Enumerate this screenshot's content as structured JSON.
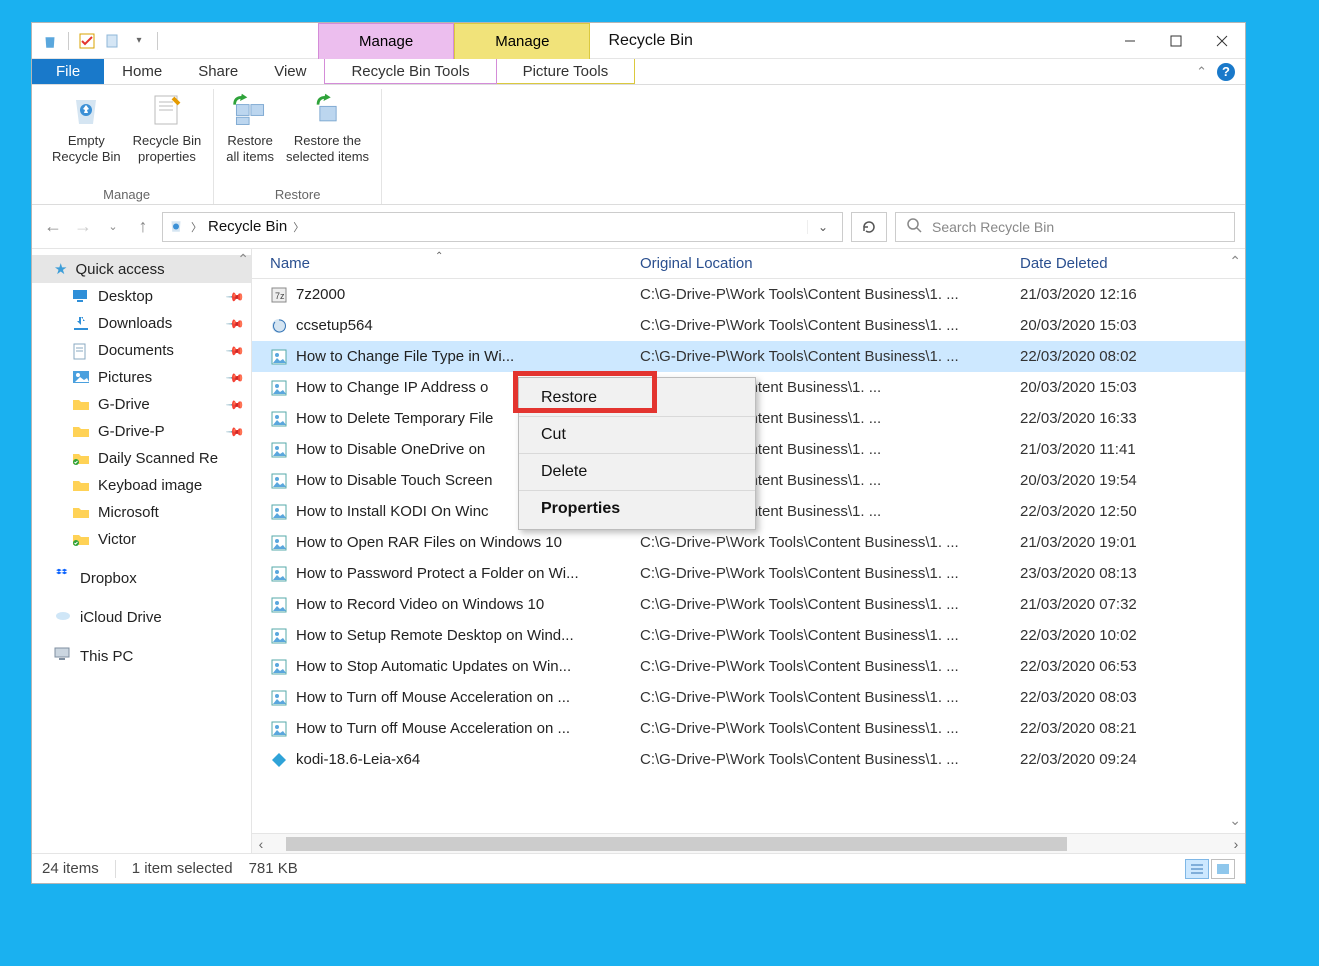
{
  "title": "Recycle Bin",
  "context_tabs": {
    "purple": "Manage",
    "yellow": "Manage"
  },
  "ribbon_tabs": {
    "file": "File",
    "home": "Home",
    "share": "Share",
    "view": "View",
    "rbt": "Recycle Bin Tools",
    "pt": "Picture Tools"
  },
  "ribbon": {
    "empty": "Empty\nRecycle Bin",
    "props": "Recycle Bin\nproperties",
    "manage_group": "Manage",
    "restore_all": "Restore\nall items",
    "restore_sel": "Restore the\nselected items",
    "restore_group": "Restore"
  },
  "addressbar": {
    "location": "Recycle Bin"
  },
  "search": {
    "placeholder": "Search Recycle Bin"
  },
  "nav": {
    "quick_access": "Quick access",
    "items": [
      {
        "label": "Desktop",
        "pinned": true,
        "icon": "desktop"
      },
      {
        "label": "Downloads",
        "pinned": true,
        "icon": "downloads"
      },
      {
        "label": "Documents",
        "pinned": true,
        "icon": "documents"
      },
      {
        "label": "Pictures",
        "pinned": true,
        "icon": "pictures"
      },
      {
        "label": "G-Drive",
        "pinned": true,
        "icon": "folder"
      },
      {
        "label": "G-Drive-P",
        "pinned": true,
        "icon": "folder"
      },
      {
        "label": "Daily Scanned Re",
        "pinned": false,
        "icon": "folder-g"
      },
      {
        "label": "Keyboad image",
        "pinned": false,
        "icon": "folder"
      },
      {
        "label": "Microsoft",
        "pinned": false,
        "icon": "folder"
      },
      {
        "label": "Victor",
        "pinned": false,
        "icon": "folder-g"
      }
    ],
    "dropbox": "Dropbox",
    "icloud": "iCloud Drive",
    "thispc": "This PC"
  },
  "columns": {
    "name": "Name",
    "location": "Original Location",
    "date": "Date Deleted"
  },
  "files": [
    {
      "name": "7z2000",
      "loc": "C:\\G-Drive-P\\Work Tools\\Content Business\\1. ...",
      "date": "21/03/2020 12:16",
      "icon": "exe"
    },
    {
      "name": "ccsetup564",
      "loc": "C:\\G-Drive-P\\Work Tools\\Content Business\\1. ...",
      "date": "20/03/2020 15:03",
      "icon": "exe2"
    },
    {
      "name": "How to Change File Type in Wi...",
      "loc": "C:\\G-Drive-P\\Work Tools\\Content Business\\1. ...",
      "date": "22/03/2020 08:02",
      "icon": "img",
      "selected": true
    },
    {
      "name": "How to Change IP Address o",
      "loc": "...Work Tools\\Content Business\\1. ...",
      "date": "20/03/2020 15:03",
      "icon": "img"
    },
    {
      "name": "How to Delete Temporary File",
      "loc": "...Work Tools\\Content Business\\1. ...",
      "date": "22/03/2020 16:33",
      "icon": "img"
    },
    {
      "name": "How to Disable OneDrive on",
      "loc": "...Work Tools\\Content Business\\1. ...",
      "date": "21/03/2020 11:41",
      "icon": "img"
    },
    {
      "name": "How to Disable Touch Screen",
      "loc": "...Work Tools\\Content Business\\1. ...",
      "date": "20/03/2020 19:54",
      "icon": "img"
    },
    {
      "name": "How to Install KODI On Winc",
      "loc": "...Work Tools\\Content Business\\1. ...",
      "date": "22/03/2020 12:50",
      "icon": "img"
    },
    {
      "name": "How to Open RAR Files on Windows 10",
      "loc": "C:\\G-Drive-P\\Work Tools\\Content Business\\1. ...",
      "date": "21/03/2020 19:01",
      "icon": "img"
    },
    {
      "name": "How to Password Protect a Folder on Wi...",
      "loc": "C:\\G-Drive-P\\Work Tools\\Content Business\\1. ...",
      "date": "23/03/2020 08:13",
      "icon": "img"
    },
    {
      "name": "How to Record Video on Windows 10",
      "loc": "C:\\G-Drive-P\\Work Tools\\Content Business\\1. ...",
      "date": "21/03/2020 07:32",
      "icon": "img"
    },
    {
      "name": "How to Setup Remote Desktop on Wind...",
      "loc": "C:\\G-Drive-P\\Work Tools\\Content Business\\1. ...",
      "date": "22/03/2020 10:02",
      "icon": "img"
    },
    {
      "name": "How to Stop Automatic Updates on Win...",
      "loc": "C:\\G-Drive-P\\Work Tools\\Content Business\\1. ...",
      "date": "22/03/2020 06:53",
      "icon": "img"
    },
    {
      "name": "How to Turn off Mouse Acceleration on ...",
      "loc": "C:\\G-Drive-P\\Work Tools\\Content Business\\1. ...",
      "date": "22/03/2020 08:03",
      "icon": "img"
    },
    {
      "name": "How to Turn off Mouse Acceleration on ...",
      "loc": "C:\\G-Drive-P\\Work Tools\\Content Business\\1. ...",
      "date": "22/03/2020 08:21",
      "icon": "img"
    },
    {
      "name": "kodi-18.6-Leia-x64",
      "loc": "C:\\G-Drive-P\\Work Tools\\Content Business\\1. ...",
      "date": "22/03/2020 09:24",
      "icon": "kodi"
    }
  ],
  "context_menu": {
    "restore": "Restore",
    "cut": "Cut",
    "delete": "Delete",
    "properties": "Properties"
  },
  "status": {
    "count": "24 items",
    "selection": "1 item selected",
    "size": "781 KB"
  }
}
